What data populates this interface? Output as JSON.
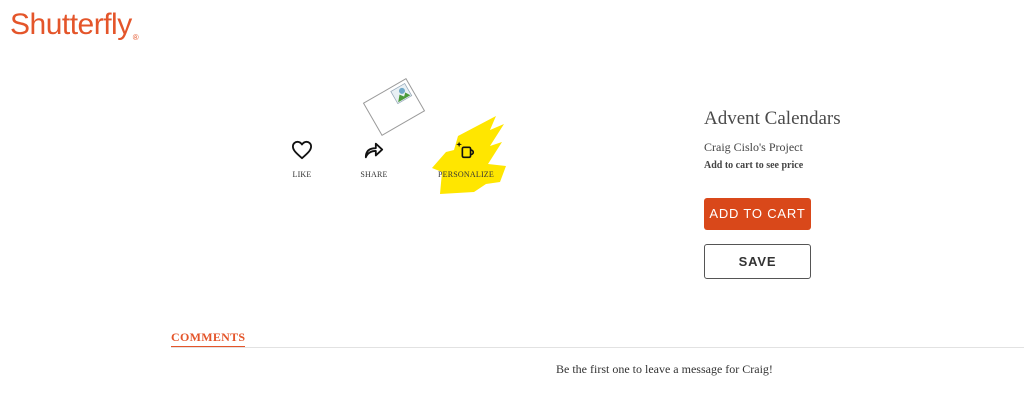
{
  "brand": {
    "name": "Shutterfly",
    "mark": "®",
    "color": "#e4552a"
  },
  "actions": [
    {
      "label": "LIKE",
      "icon": "heart-icon"
    },
    {
      "label": "SHARE",
      "icon": "share-arrow-icon"
    },
    {
      "label": "PERSONALIZE",
      "icon": "personalize-mug-icon"
    }
  ],
  "product": {
    "title": "Advent Calendars",
    "owner": "Craig Cislo's Project",
    "price_note": "Add to cart to see price"
  },
  "buttons": {
    "add_to_cart": "ADD TO CART",
    "save": "SAVE"
  },
  "colors": {
    "accent": "#d9481a",
    "highlight": "#ffe600"
  },
  "comments": {
    "tab_label": "COMMENTS",
    "empty_message": "Be the first one to leave a message for Craig!"
  }
}
